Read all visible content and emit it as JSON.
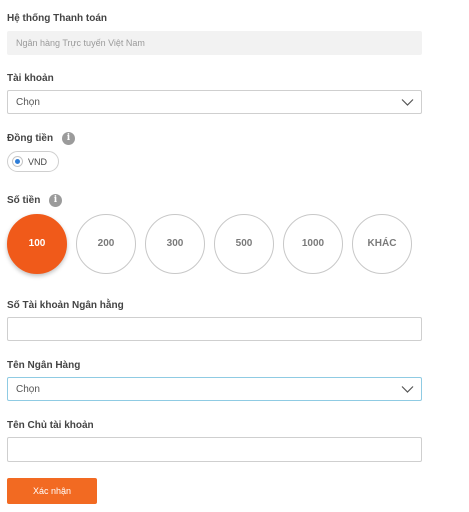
{
  "payment_system": {
    "label": "Hệ thống Thanh toán",
    "value": "Ngân hàng Trực tuyến Việt Nam"
  },
  "account": {
    "label": "Tài khoản",
    "value": "Chọn"
  },
  "currency": {
    "label": "Đồng tiền",
    "info_glyph": "i",
    "option": "VND",
    "selected": true
  },
  "amount": {
    "label": "Số tiền",
    "info_glyph": "i",
    "options": [
      "100",
      "200",
      "300",
      "500",
      "1000",
      "KHÁC"
    ],
    "selected": "100",
    "accent_color": "#f05a1a"
  },
  "bank_account_number": {
    "label": "Số Tài khoản Ngân hằng",
    "value": ""
  },
  "bank_name": {
    "label": "Tên Ngân Hàng",
    "value": "Chọn"
  },
  "account_holder": {
    "label": "Tên Chủ tài khoản",
    "value": ""
  },
  "submit": {
    "label": "Xác nhận",
    "color": "#f26a22"
  }
}
